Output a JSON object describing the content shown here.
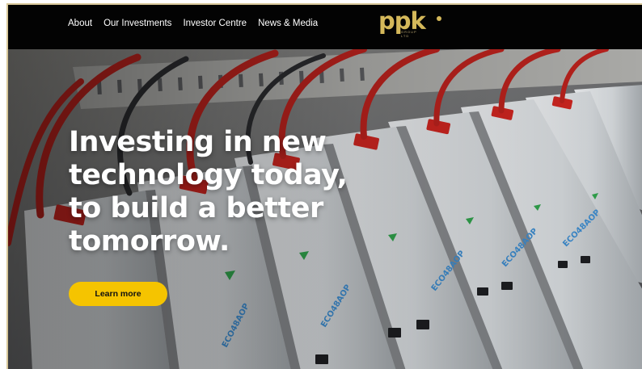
{
  "nav": {
    "links": [
      "About",
      "Our Investments",
      "Investor Centre",
      "News & Media"
    ],
    "logo": {
      "text": "ppk",
      "sub": "GROUP LTD"
    }
  },
  "hero": {
    "headline": [
      "Investing in new",
      "technology today,",
      "to build a better",
      "tomorrow."
    ],
    "cta_label": "Learn more",
    "battery_label": "ECO48AOP"
  },
  "colors": {
    "nav_bg": "#030303",
    "logo_gold": "#d4b85a",
    "cta_yellow": "#f5c400",
    "cable_red": "#b5211c"
  }
}
